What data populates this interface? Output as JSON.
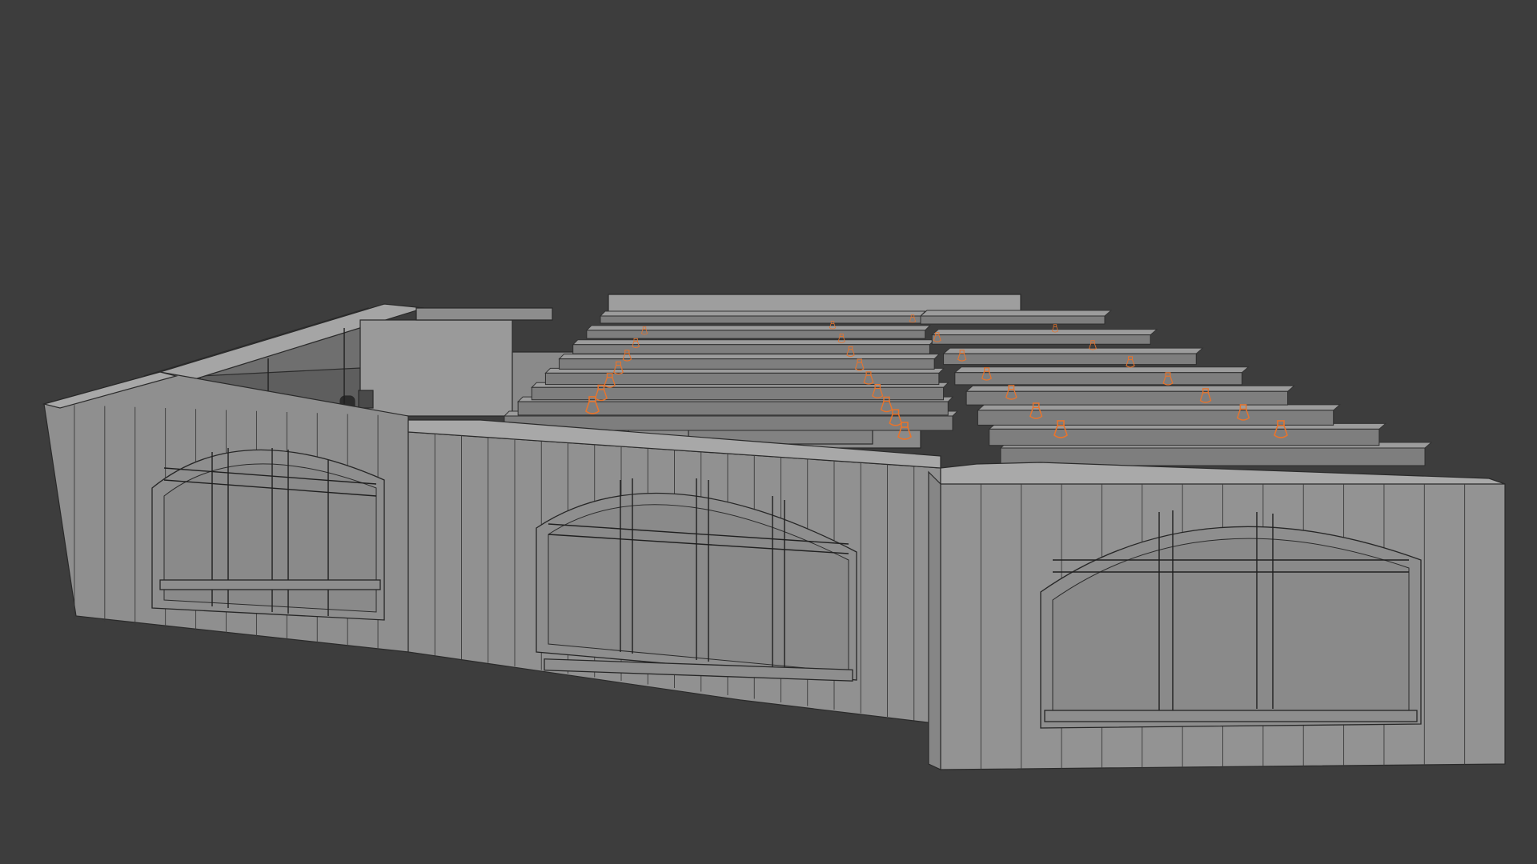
{
  "viewport": {
    "background": "#3d3d3d",
    "shading": "solid-wireframe-overlay"
  },
  "model": {
    "object": "building-interior-shell",
    "wall_color": "#8f8f8f",
    "edge_color": "#2a2a2a",
    "light_color": "#e8742c",
    "arched_windows": 3,
    "roof_beams": 16,
    "ceiling_lights": 30
  }
}
